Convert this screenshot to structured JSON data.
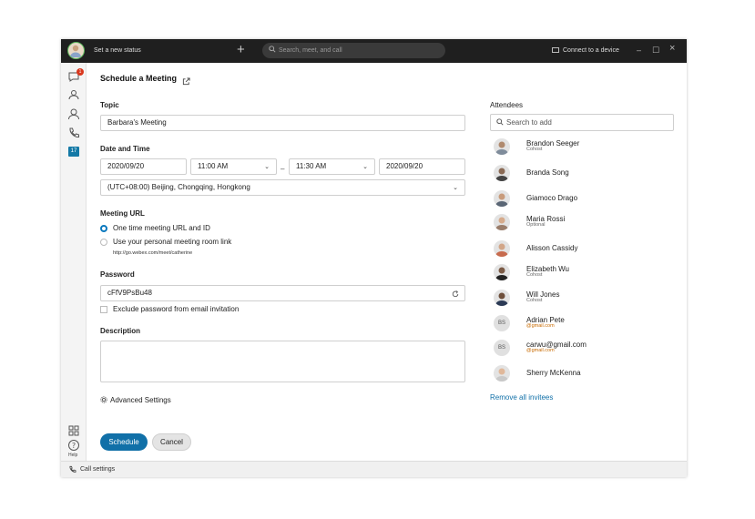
{
  "titlebar": {
    "status": "Set a new status",
    "search_placeholder": "Search, meet, and call",
    "connect": "Connect to a device",
    "minimize": "–",
    "maximize": "☐",
    "close": "×"
  },
  "sidebar": {
    "badge": "1",
    "calendar_day": "17",
    "help": "Help"
  },
  "footer": {
    "call_settings": "Call settings"
  },
  "form": {
    "title": "Schedule a Meeting",
    "topic_label": "Topic",
    "topic_value": "Barbara's Meeting",
    "datetime_label": "Date and Time",
    "start_date": "2020/09/20",
    "start_time": "11:00 AM",
    "dash": "–",
    "end_time": "11:30 AM",
    "end_date": "2020/09/20",
    "timezone": "(UTC+08:00) Beijing, Chongqing, Hongkong",
    "url_label": "Meeting URL",
    "url_option1": "One time meeting URL and ID",
    "url_option2": "Use your personal meeting room link",
    "personal_url": "http://go.webex.com/meet/catherine",
    "password_label": "Password",
    "password_value": "cFfV9PsBu48",
    "exclude_password": "Exclude password from email invitation",
    "description_label": "Description",
    "advanced": "Advanced Settings",
    "schedule": "Schedule",
    "cancel": "Cancel"
  },
  "attendees": {
    "label": "Attendees",
    "search_placeholder": "Search to add",
    "remove_all": "Remove all invitees",
    "list": [
      {
        "name": "Brandon Seeger",
        "role": "Cohost"
      },
      {
        "name": "Branda Song",
        "role": ""
      },
      {
        "name": "Giamoco Drago",
        "role": ""
      },
      {
        "name": "Maria Rossi",
        "role": "Optional"
      },
      {
        "name": "Alisson Cassidy",
        "role": ""
      },
      {
        "name": "Elizabeth Wu",
        "role": "Cohost"
      },
      {
        "name": "Will Jones",
        "role": "Cohost"
      },
      {
        "name": "Adrian Pete",
        "role": "@gmail.com",
        "initials": "BS"
      },
      {
        "name": "carwu@gmail.com",
        "role": "@gmail.com",
        "initials": "BS"
      },
      {
        "name": "Sherry McKenna",
        "role": ""
      }
    ]
  },
  "colors": {
    "accent": "#1170a8",
    "titlebar": "#1f1f1f",
    "badge": "#d9381e",
    "email_role": "#c86a00"
  }
}
